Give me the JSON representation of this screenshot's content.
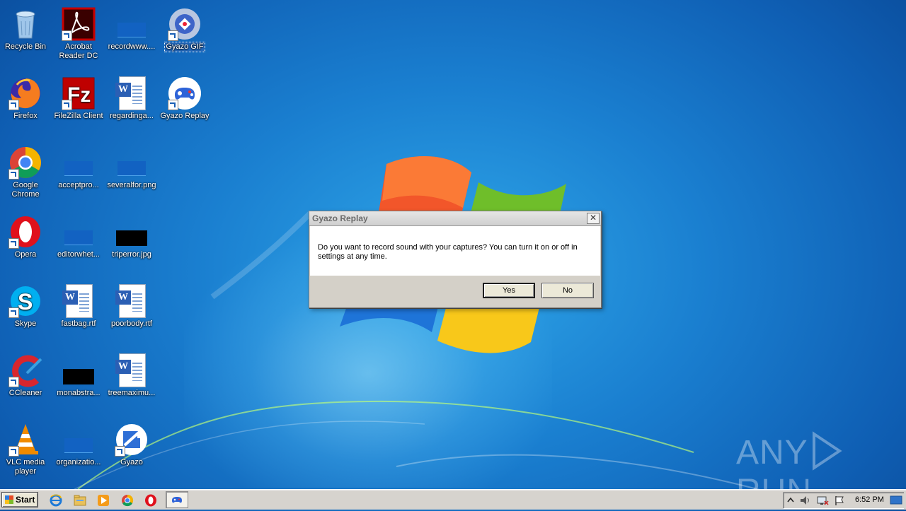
{
  "desktop": {
    "icons": [
      {
        "id": "recycle-bin",
        "label": "Recycle Bin"
      },
      {
        "id": "acrobat",
        "label": "Acrobat Reader DC"
      },
      {
        "id": "recordwww",
        "label": "recordwww...."
      },
      {
        "id": "gyazo-gif",
        "label": "Gyazo GIF"
      },
      {
        "id": "firefox",
        "label": "Firefox"
      },
      {
        "id": "filezilla",
        "label": "FileZilla Client"
      },
      {
        "id": "regardinga",
        "label": "regardinga..."
      },
      {
        "id": "gyazo-replay",
        "label": "Gyazo Replay"
      },
      {
        "id": "chrome",
        "label": "Google Chrome"
      },
      {
        "id": "acceptpro",
        "label": "acceptpro..."
      },
      {
        "id": "severalfor",
        "label": "severalfor.png"
      },
      {
        "id": "opera",
        "label": "Opera"
      },
      {
        "id": "editorwhet",
        "label": "editorwhet..."
      },
      {
        "id": "triperror",
        "label": "triperror.jpg"
      },
      {
        "id": "skype",
        "label": "Skype"
      },
      {
        "id": "fastbag",
        "label": "fastbag.rtf"
      },
      {
        "id": "poorbody",
        "label": "poorbody.rtf"
      },
      {
        "id": "ccleaner",
        "label": "CCleaner"
      },
      {
        "id": "monabstra",
        "label": "monabstra..."
      },
      {
        "id": "treemaximu",
        "label": "treemaximu..."
      },
      {
        "id": "vlc",
        "label": "VLC media player"
      },
      {
        "id": "organizatio",
        "label": "organizatio..."
      },
      {
        "id": "gyazo",
        "label": "Gyazo"
      }
    ]
  },
  "dialog": {
    "title": "Gyazo Replay",
    "close_label": "✕",
    "message": "Do you want to record sound with your captures? You can turn it on or off in settings at any time.",
    "yes_label": "Yes",
    "no_label": "No"
  },
  "taskbar": {
    "start_label": "Start",
    "clock": "6:52 PM"
  },
  "watermark": {
    "left": "ANY",
    "right": "RUN"
  }
}
